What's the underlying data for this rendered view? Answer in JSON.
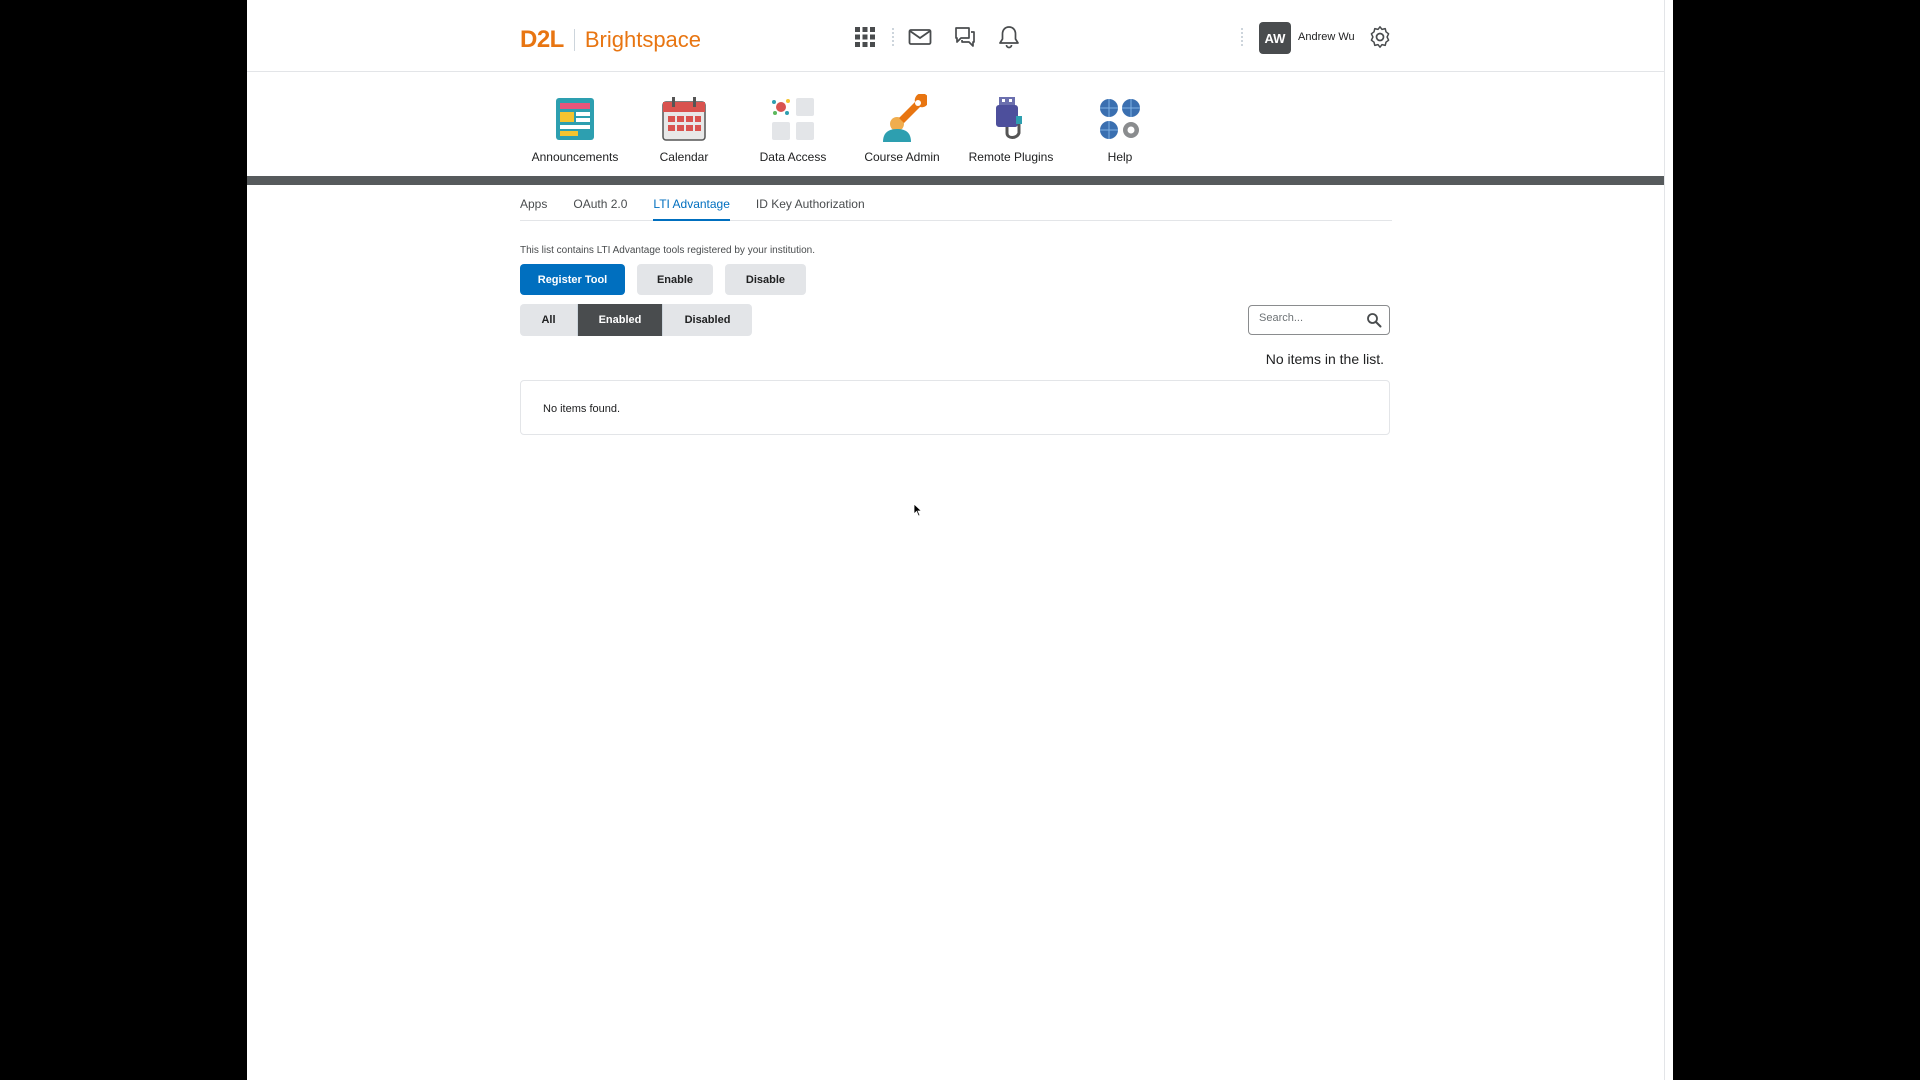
{
  "header": {
    "logo_brand": "D2L",
    "logo_product": "Brightspace",
    "user_initials": "AW",
    "user_name": "Andrew Wu"
  },
  "navbar": {
    "items": [
      {
        "label": "Announcements",
        "icon": "announcements-icon"
      },
      {
        "label": "Calendar",
        "icon": "calendar-icon"
      },
      {
        "label": "Data Access",
        "icon": "data-access-icon"
      },
      {
        "label": "Course Admin",
        "icon": "course-admin-icon"
      },
      {
        "label": "Remote Plugins",
        "icon": "remote-plugins-icon"
      },
      {
        "label": "Help",
        "icon": "help-icon"
      }
    ]
  },
  "tabs": [
    {
      "label": "Apps",
      "active": false
    },
    {
      "label": "OAuth 2.0",
      "active": false
    },
    {
      "label": "LTI Advantage",
      "active": true
    },
    {
      "label": "ID Key Authorization",
      "active": false
    }
  ],
  "description": "This list contains LTI Advantage tools registered by your institution.",
  "actions": {
    "register": "Register Tool",
    "enable": "Enable",
    "disable": "Disable"
  },
  "filter": {
    "all": "All",
    "enabled": "Enabled",
    "disabled": "Disabled",
    "selected": "Enabled"
  },
  "search": {
    "placeholder": "Search..."
  },
  "list": {
    "count_text": "No items in the list.",
    "empty_text": "No items found."
  },
  "colors": {
    "brand": "#e87511",
    "primary": "#006fbf",
    "nav_bar": "#565a5c"
  }
}
